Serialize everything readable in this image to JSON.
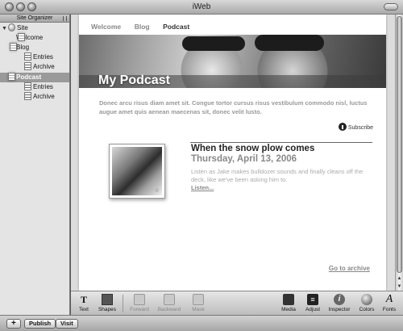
{
  "window": {
    "title": "iWeb"
  },
  "sidebar": {
    "header": "Site Organizer",
    "items": [
      {
        "label": "Site",
        "icon": "globe-icon"
      },
      {
        "label": "Welcome",
        "icon": "page-icon"
      },
      {
        "label": "Blog",
        "icon": "page-icon"
      },
      {
        "label": "Entries",
        "icon": "list-icon"
      },
      {
        "label": "Archive",
        "icon": "list-icon"
      },
      {
        "label": "Podcast",
        "icon": "page-icon"
      },
      {
        "label": "Entries",
        "icon": "list-icon"
      },
      {
        "label": "Archive",
        "icon": "list-icon"
      }
    ]
  },
  "page": {
    "nav": [
      "Welcome",
      "Blog",
      "Podcast"
    ],
    "active_nav": "Podcast",
    "banner_title": "My Podcast",
    "intro": "Donec arcu risus diam amet sit. Congue tortor cursus risus vestibulum commodo nisl, luctus augue amet quis aenean maecenas sit, donec velit lusto.",
    "subscribe": "Subscribe",
    "entry": {
      "title": "When the snow plow comes",
      "date": "Thursday, April 13, 2006",
      "body": "Listen as Jake makes bulldozer sounds and  finally cleans off the deck, like we've been asking him to.",
      "listen": "Listen..."
    },
    "archive_link": "Go to archive"
  },
  "toolbar": {
    "text": "Text",
    "shapes": "Shapes",
    "forward": "Forward",
    "backward": "Backward",
    "mask": "Mask",
    "media": "Media",
    "adjust": "Adjust",
    "inspector": "Inspector",
    "colors": "Colors",
    "fonts": "Fonts"
  },
  "bottombar": {
    "add": "+",
    "publish": "Publish",
    "visit": "Visit"
  }
}
